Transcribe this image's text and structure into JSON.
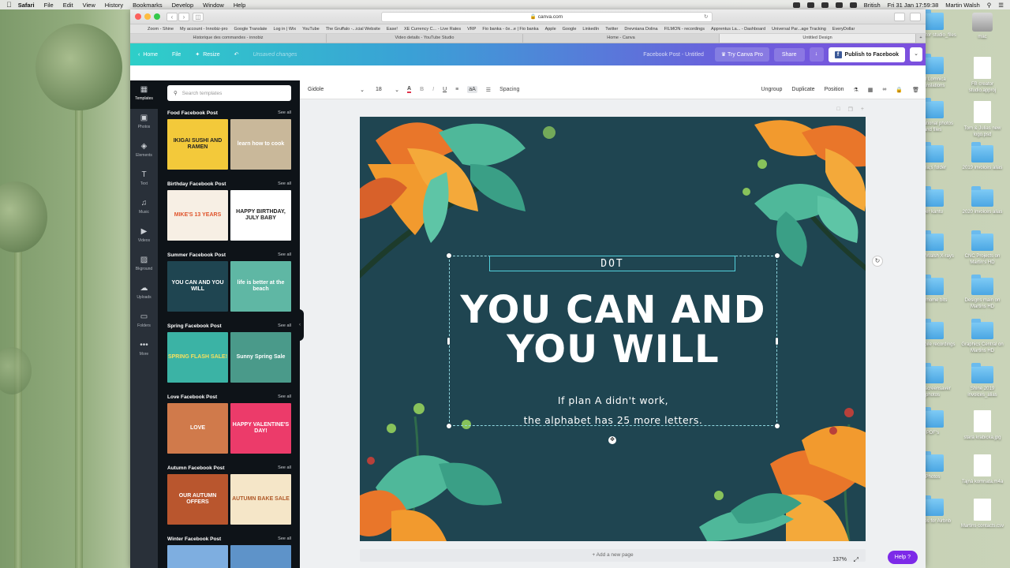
{
  "menubar": {
    "app": "Safari",
    "items": [
      "File",
      "Edit",
      "View",
      "History",
      "Bookmarks",
      "Develop",
      "Window",
      "Help"
    ],
    "lang": "British",
    "datetime": "Fri 31 Jan  17:59:38",
    "user": "Martin Walsh"
  },
  "browser": {
    "url": "canva.com",
    "favorites": [
      "Zoom - Shine",
      "My account - Innobiz-pro",
      "Google Translate",
      "Log in | Wix",
      "YouTube",
      "The Gruffalo -...icial Website",
      "Ease!",
      "XE Currency C... - Live Rates",
      "VRP",
      "Fio banka - če...e | Fio banka",
      "Apple",
      "Google",
      "LinkedIn",
      "Twitter",
      "Drevniana Dolina",
      "FILMON - recordings",
      "Apprentus La... - Dashboard",
      "Universal Par...age Tracking",
      "EveryDollar"
    ],
    "tabs": [
      {
        "label": "Historique des commandes - innobiz",
        "active": false
      },
      {
        "label": "Video details - YouTube Studio",
        "active": false
      },
      {
        "label": "Home - Canva",
        "active": false
      },
      {
        "label": "Untitled Design",
        "active": true
      }
    ]
  },
  "canva_top": {
    "home": "Home",
    "file": "File",
    "resize": "Resize",
    "status": "Unsaved changes",
    "doc_title": "Facebook Post - Untitled",
    "try_pro": "Try Canva Pro",
    "share": "Share",
    "publish": "Publish to Facebook"
  },
  "rail": [
    {
      "label": "Templates",
      "icon": "templates-icon",
      "glyph": "▦"
    },
    {
      "label": "Photos",
      "icon": "photos-icon",
      "glyph": "▣"
    },
    {
      "label": "Elements",
      "icon": "elements-icon",
      "glyph": "◈"
    },
    {
      "label": "Text",
      "icon": "text-icon",
      "glyph": "T"
    },
    {
      "label": "Music",
      "icon": "music-icon",
      "glyph": "♫"
    },
    {
      "label": "Videos",
      "icon": "videos-icon",
      "glyph": "▶"
    },
    {
      "label": "Bkground",
      "icon": "background-icon",
      "glyph": "▨"
    },
    {
      "label": "Uploads",
      "icon": "uploads-icon",
      "glyph": "☁"
    },
    {
      "label": "Folders",
      "icon": "folders-icon",
      "glyph": "▭"
    },
    {
      "label": "More",
      "icon": "more-icon",
      "glyph": "•••"
    }
  ],
  "panel": {
    "search_placeholder": "Search templates",
    "see_all": "See all",
    "sections": [
      {
        "title": "Food Facebook Post",
        "thumbs": [
          {
            "text": "IKIGAI SUSHI AND RAMEN",
            "bg": "#f3c93a",
            "fg": "#222"
          },
          {
            "text": "learn how to cook",
            "bg": "#c9b89a",
            "fg": "#fff"
          }
        ]
      },
      {
        "title": "Birthday Facebook Post",
        "thumbs": [
          {
            "text": "MIKE'S 13 YEARS",
            "bg": "#f7efe4",
            "fg": "#e0552d"
          },
          {
            "text": "HAPPY BIRTHDAY, JULY BABY",
            "bg": "#ffffff",
            "fg": "#222"
          }
        ]
      },
      {
        "title": "Summer Facebook Post",
        "thumbs": [
          {
            "text": "YOU CAN AND YOU WILL",
            "bg": "#1f4551",
            "fg": "#fff"
          },
          {
            "text": "life is better at the beach",
            "bg": "#5fb7a4",
            "fg": "#fff"
          }
        ]
      },
      {
        "title": "Spring Facebook Post",
        "thumbs": [
          {
            "text": "SPRING FLASH SALE!",
            "bg": "#3bb3a5",
            "fg": "#f6e05e"
          },
          {
            "text": "Sunny Spring Sale",
            "bg": "#4a9a8a",
            "fg": "#fff"
          }
        ]
      },
      {
        "title": "Love Facebook Post",
        "thumbs": [
          {
            "text": "LOVE",
            "bg": "#d07a4b",
            "fg": "#fff"
          },
          {
            "text": "HAPPY VALENTINE'S DAY!",
            "bg": "#ec3b6a",
            "fg": "#fff"
          }
        ]
      },
      {
        "title": "Autumn Facebook Post",
        "thumbs": [
          {
            "text": "OUR AUTUMN OFFERS",
            "bg": "#b9562e",
            "fg": "#fff"
          },
          {
            "text": "AUTUMN BAKE SALE",
            "bg": "#f5e6c8",
            "fg": "#b05a2a"
          }
        ]
      },
      {
        "title": "Winter Facebook Post",
        "thumbs": [
          {
            "text": "",
            "bg": "#7eaee0",
            "fg": "#fff"
          },
          {
            "text": "",
            "bg": "#5e93c9",
            "fg": "#fff"
          }
        ]
      }
    ]
  },
  "toolbar": {
    "font": "Gidole",
    "size": "18",
    "spacing": "Spacing",
    "ungroup": "Ungroup",
    "duplicate": "Duplicate",
    "position": "Position"
  },
  "canvas": {
    "bg": "#1f4551",
    "dot_text": "DOT",
    "headline_1": "YOU CAN AND",
    "headline_2": "YOU WILL",
    "sub_1": "If plan A didn't work,",
    "sub_2": "the alphabet has 25 more letters."
  },
  "footer": {
    "add_page": "+ Add a new page",
    "zoom": "137%",
    "help": "Help ?"
  },
  "desktop_icons": [
    {
      "label": "FB creator studio_files",
      "kind": "folder"
    },
    {
      "label": "mac",
      "kind": "disk"
    },
    {
      "label": "Nel Lomnica translations",
      "kind": "folder"
    },
    {
      "label": "FB creator studio.approj",
      "kind": "file"
    },
    {
      "label": "Inspirational photos and files",
      "kind": "folder"
    },
    {
      "label": "Tom & Julias new logo.psd",
      "kind": "file"
    },
    {
      "label": "Jana;s folder",
      "kind": "folder"
    },
    {
      "label": "2019 invoices alias",
      "kind": "folder"
    },
    {
      "label": "Ker kantu",
      "kind": "folder"
    },
    {
      "label": "2020 invoices alias",
      "kind": "folder"
    },
    {
      "label": "Martin Walsh X-rays",
      "kind": "folder"
    },
    {
      "label": "CNC Projects on Martin's HD",
      "kind": "folder"
    },
    {
      "label": "Warhome bits",
      "kind": "folder"
    },
    {
      "label": "Designs main on Martins HD",
      "kind": "folder"
    },
    {
      "label": "My mobile recordings",
      "kind": "folder"
    },
    {
      "label": "Graphics Central on Martins HD",
      "kind": "folder"
    },
    {
      "label": "Mac screensaver photos",
      "kind": "folder"
    },
    {
      "label": "Shine 2019 invoices_alias",
      "kind": "folder"
    },
    {
      "label": "PDF's",
      "kind": "folder"
    },
    {
      "label": "stara krabicka.jpg",
      "kind": "file"
    },
    {
      "label": "Photos",
      "kind": "folder"
    },
    {
      "label": "Tajná komnata.m4a",
      "kind": "file"
    },
    {
      "label": "Photos for Airbnb",
      "kind": "folder"
    },
    {
      "label": "Martins contacts.csv",
      "kind": "file"
    }
  ]
}
